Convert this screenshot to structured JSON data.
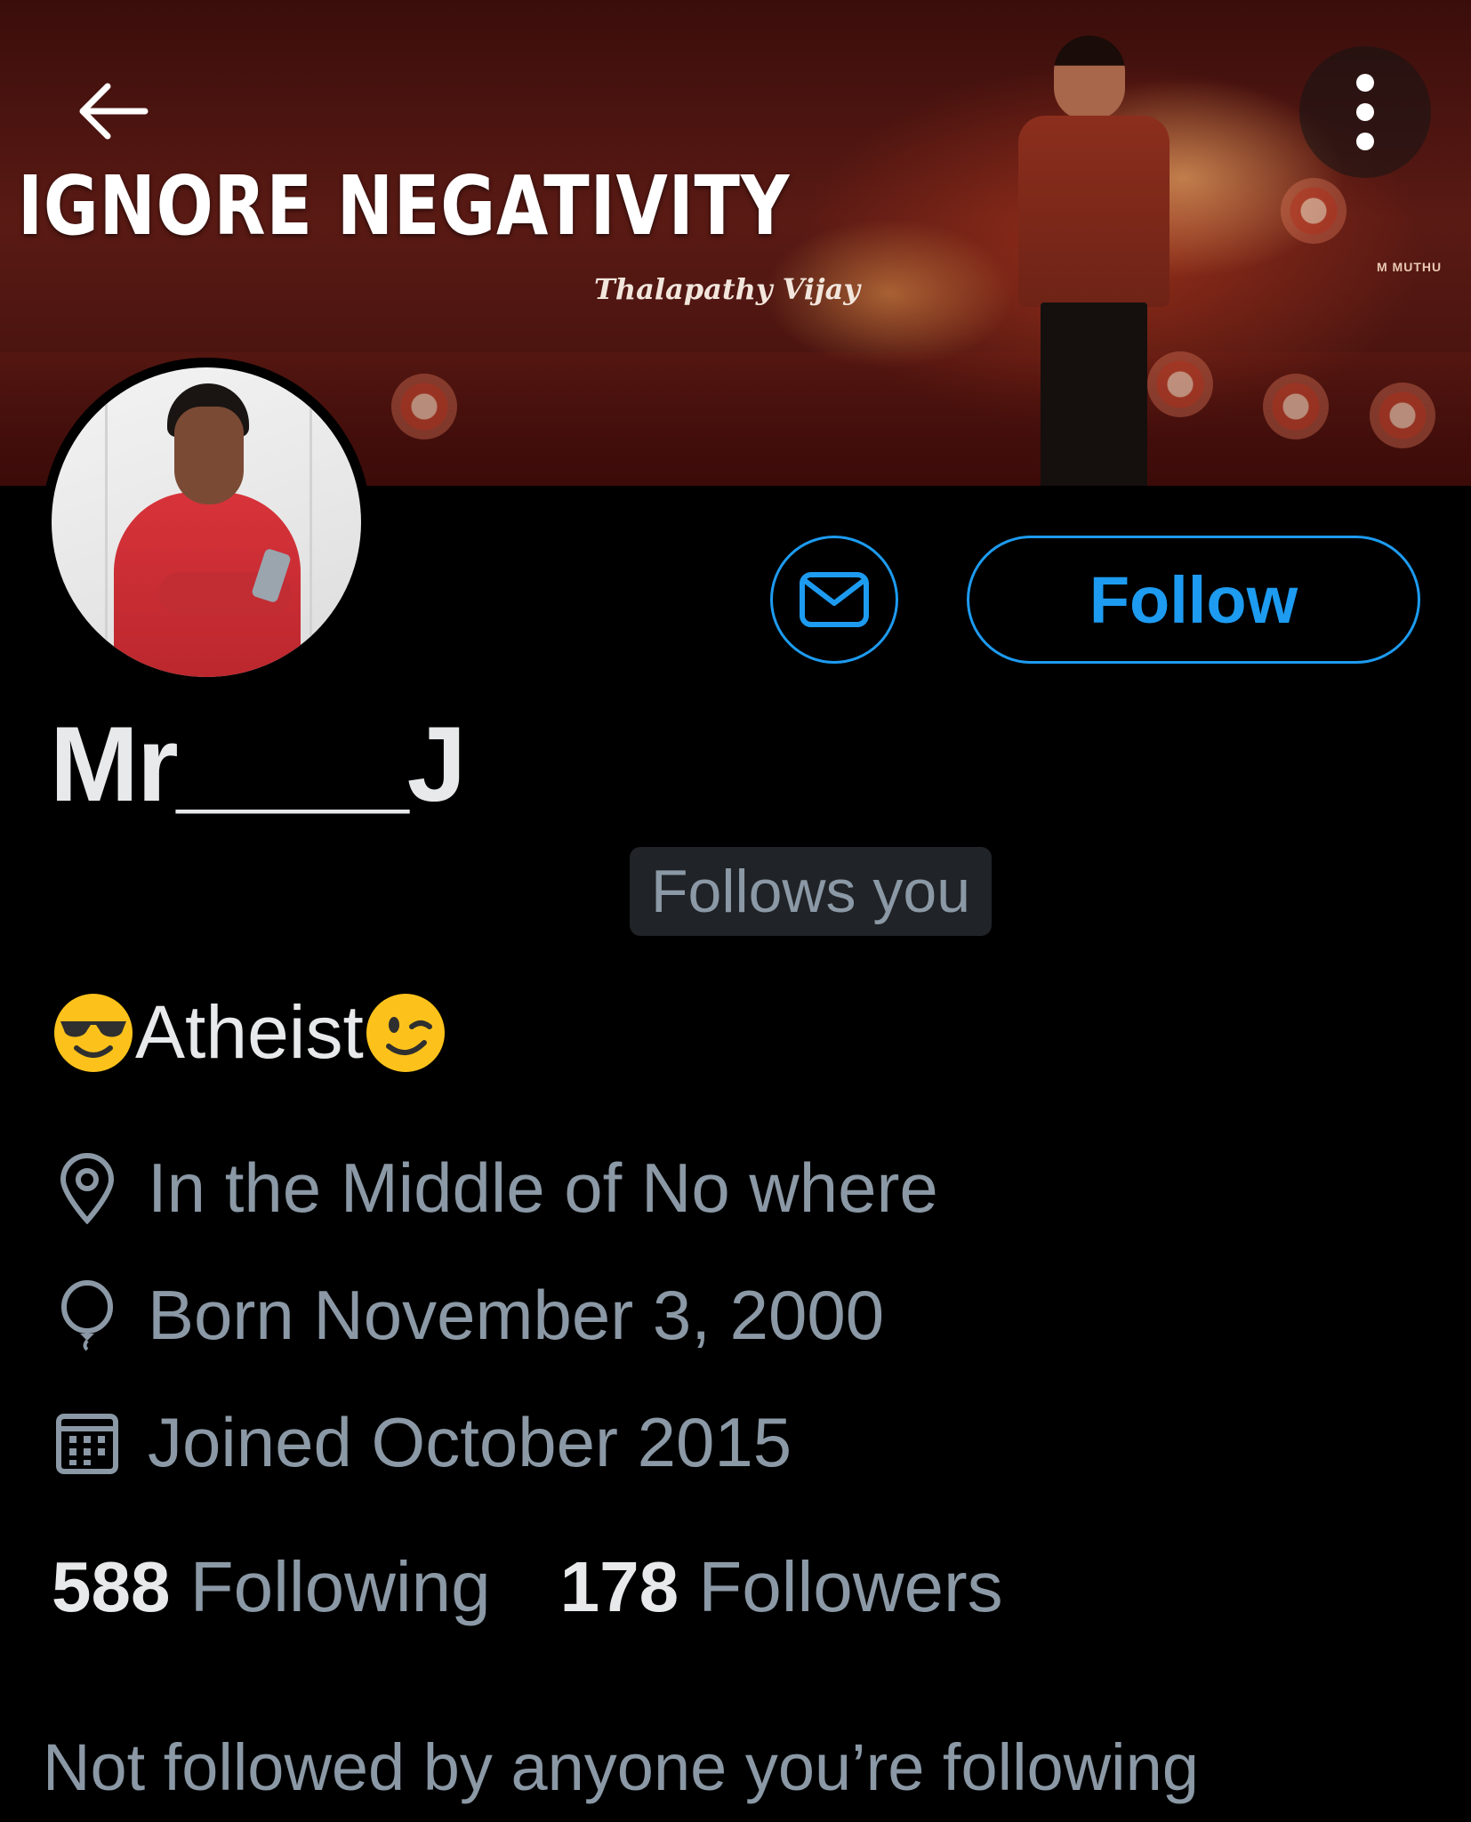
{
  "banner": {
    "title": "IGNORE NEGATIVITY",
    "signature": "Thalapathy Vijay",
    "tag": "M MUTHU"
  },
  "header": {
    "back_icon": "arrow-left-icon",
    "menu_icon": "more-vertical-icon"
  },
  "profile": {
    "display_name": "Mr____J",
    "follows_you": "Follows you",
    "bio_text": "Atheist",
    "bio_emoji_before": "smiling-face-with-sunglasses-emoji",
    "bio_emoji_after": "winking-face-emoji",
    "location": "In the Middle of No where",
    "birthday": "Born November 3, 2000",
    "joined": "Joined October 2015"
  },
  "actions": {
    "message_icon": "mail-icon",
    "follow_label": "Follow"
  },
  "stats": {
    "following_count": "588",
    "following_label": "Following",
    "followers_count": "178",
    "followers_label": "Followers"
  },
  "mutuals": {
    "text": "Not followed by anyone you’re following"
  },
  "colors": {
    "accent": "#1d9bf0",
    "background": "#000000",
    "secondary_text": "#8b98a5",
    "primary_text": "#e7e9ea",
    "badge_bg": "#202327"
  }
}
